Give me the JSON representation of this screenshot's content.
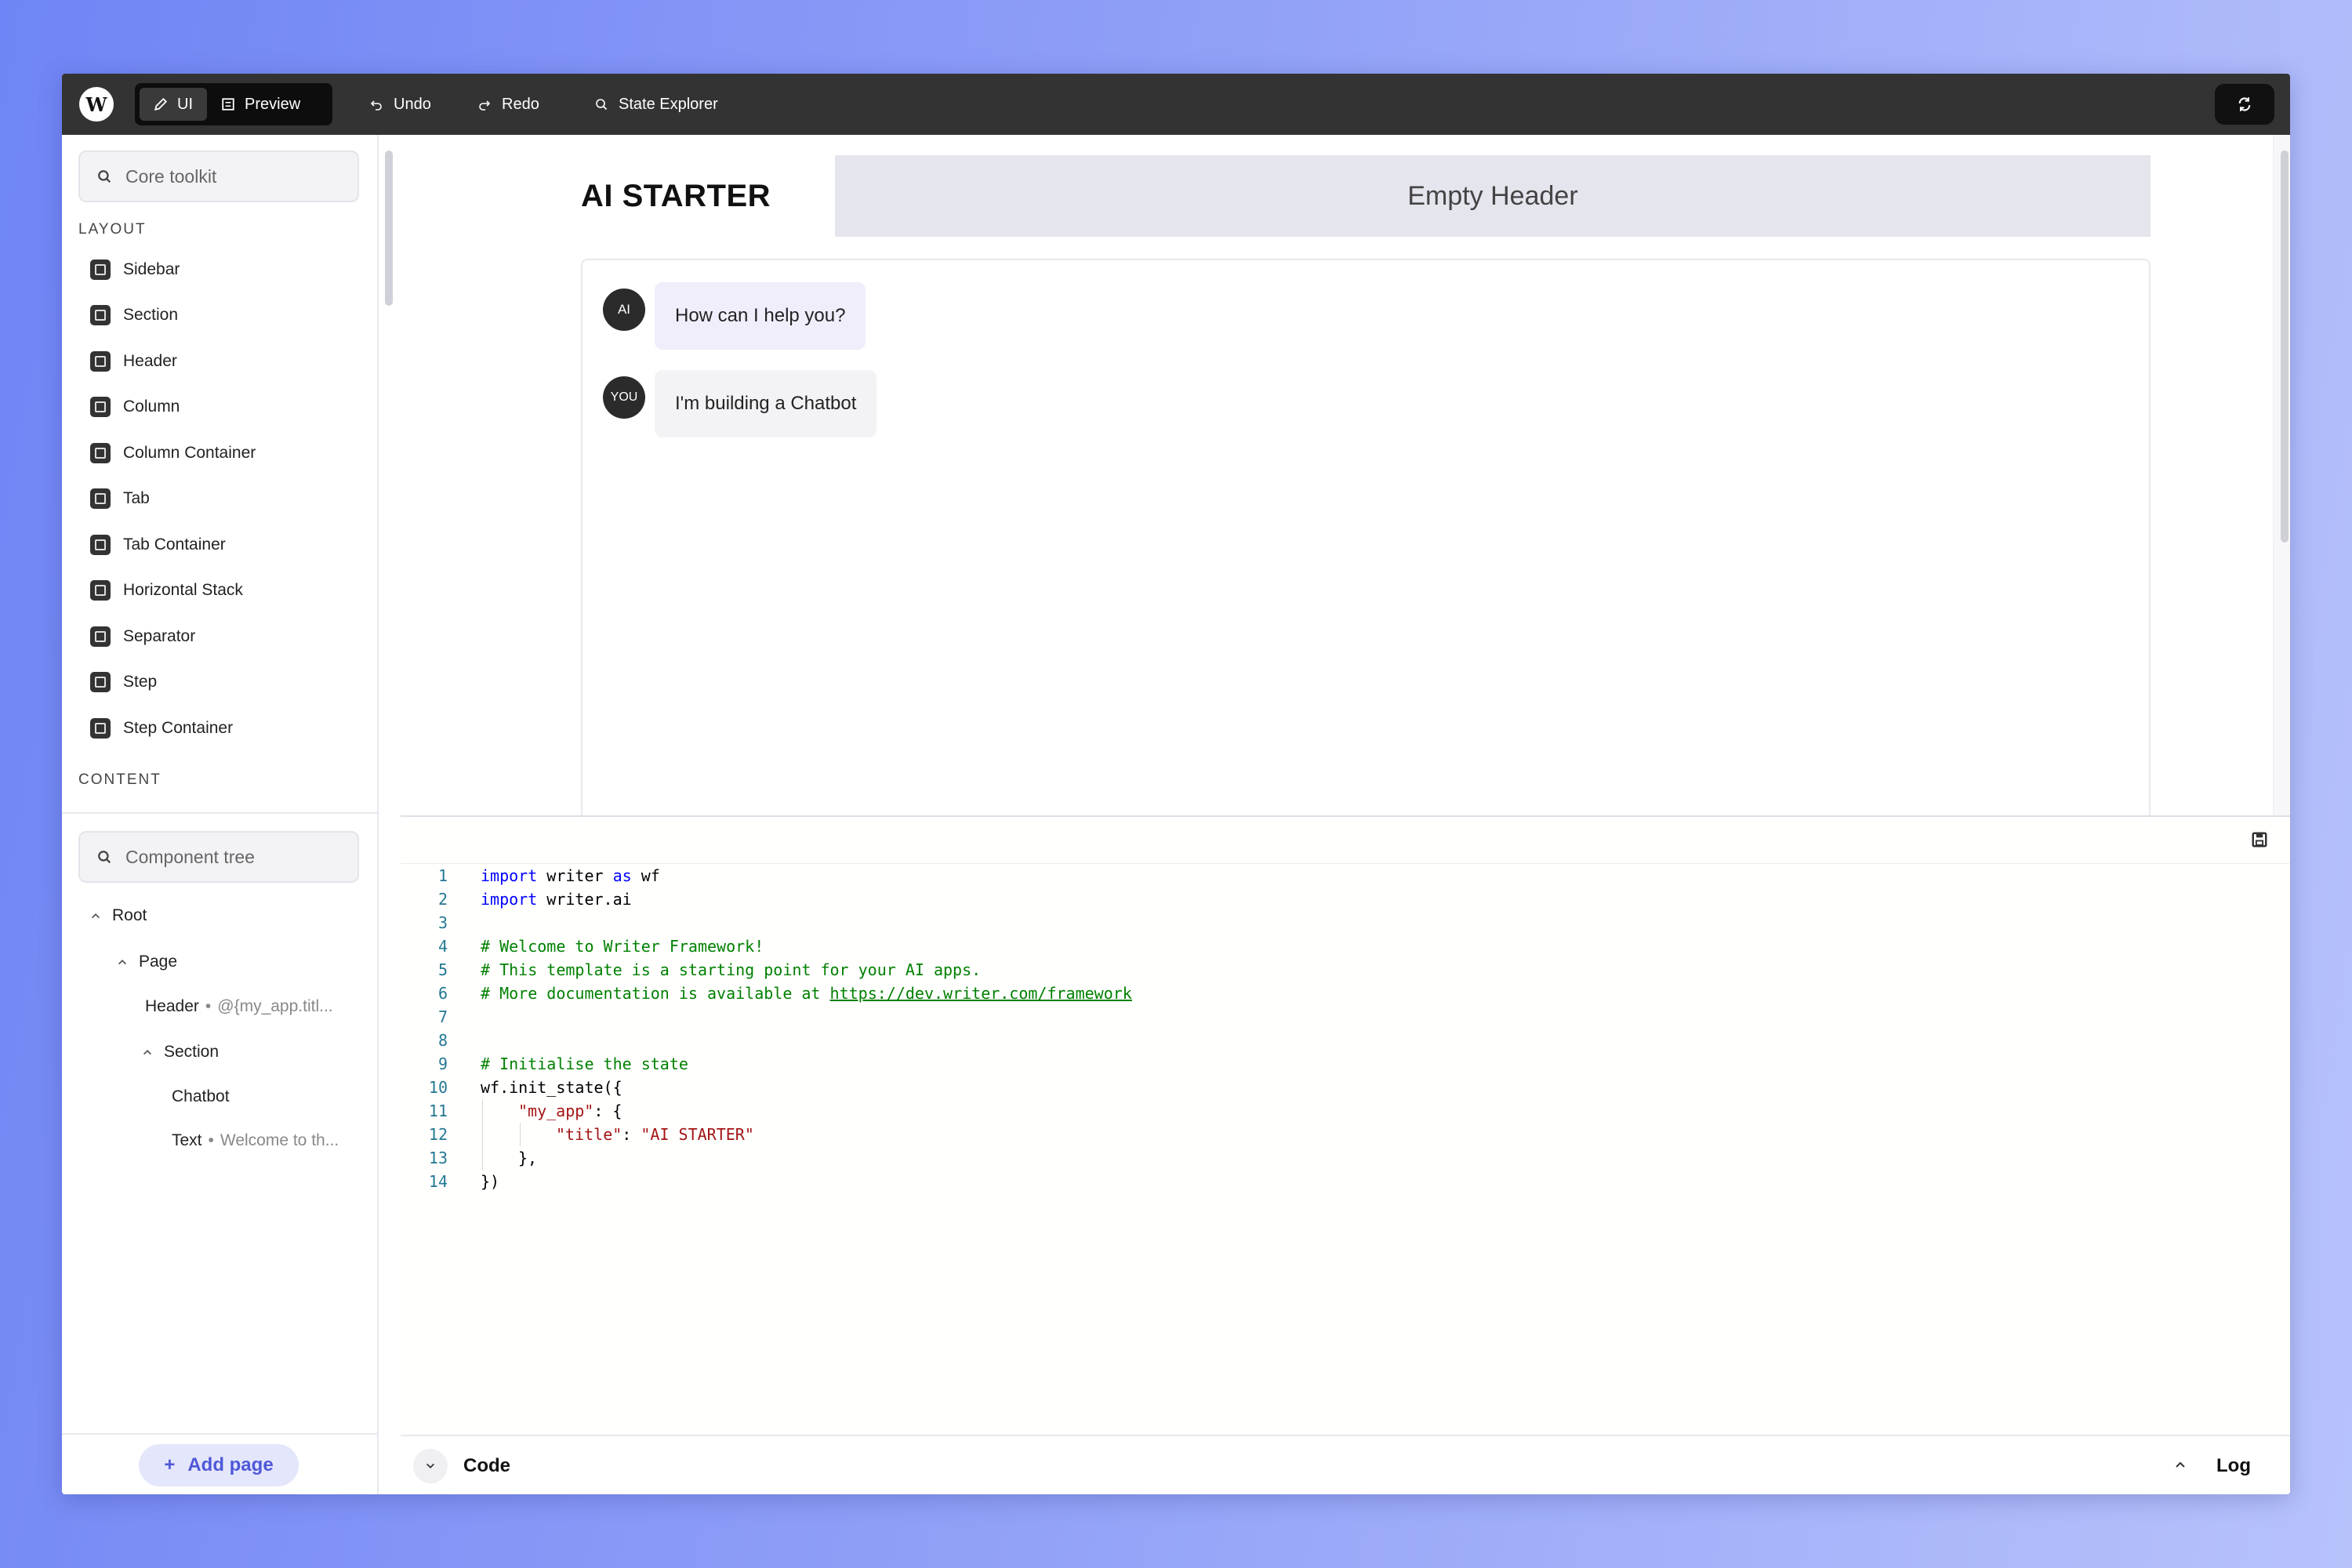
{
  "topbar": {
    "logo": "W",
    "modes": [
      {
        "label": "UI",
        "icon": "pencil-icon",
        "active": true
      },
      {
        "label": "Preview",
        "icon": "preview-icon",
        "active": false
      }
    ],
    "undo_label": "Undo",
    "redo_label": "Redo",
    "state_explorer_label": "State Explorer"
  },
  "toolkit": {
    "search_placeholder": "Core toolkit",
    "layout_label": "LAYOUT",
    "content_label": "CONTENT",
    "items": [
      {
        "label": "Sidebar"
      },
      {
        "label": "Section"
      },
      {
        "label": "Header"
      },
      {
        "label": "Column"
      },
      {
        "label": "Column Container"
      },
      {
        "label": "Tab"
      },
      {
        "label": "Tab Container"
      },
      {
        "label": "Horizontal Stack"
      },
      {
        "label": "Separator"
      },
      {
        "label": "Step"
      },
      {
        "label": "Step Container"
      }
    ]
  },
  "tree": {
    "search_placeholder": "Component tree",
    "root": "Root",
    "page": "Page",
    "header": "Header",
    "header_sub": "@{my_app.titl...",
    "section": "Section",
    "chatbot": "Chatbot",
    "text": "Text",
    "text_sub": "Welcome to th...",
    "add_page": "Add page"
  },
  "canvas": {
    "app_title": "AI STARTER",
    "empty_header": "Empty Header",
    "messages": [
      {
        "avatar": "AI",
        "text": "How can I help you?"
      },
      {
        "avatar": "YOU",
        "text": "I'm building a Chatbot"
      }
    ]
  },
  "code": {
    "line_numbers": [
      "1",
      "2",
      "3",
      "4",
      "5",
      "6",
      "7",
      "8",
      "9",
      "10",
      "11",
      "12",
      "13",
      "14"
    ],
    "l1_kw1": "import",
    "l1_mid": " writer ",
    "l1_kw2": "as",
    "l1_end": " wf",
    "l2_kw": "import",
    "l2_end": " writer.ai",
    "l4": "# Welcome to Writer Framework!",
    "l5": "# This template is a starting point for your AI apps.",
    "l6_pre": "# More documentation is available at ",
    "l6_link": "https://dev.writer.com/framework",
    "l9": "# Initialise the state",
    "l10": "wf.init_state({",
    "l11_key": "\"my_app\"",
    "l11_rest": ": {",
    "l12_key": "\"title\"",
    "l12_sep": ": ",
    "l12_val": "\"AI STARTER\"",
    "l13": "},",
    "l14": "})"
  },
  "bottombar": {
    "code_label": "Code",
    "log_label": "Log"
  },
  "colors": {
    "accent": "#4f58d8",
    "topbar": "#333333",
    "ai_bubble": "#f1eefc",
    "user_bubble": "#f3f3f6"
  }
}
